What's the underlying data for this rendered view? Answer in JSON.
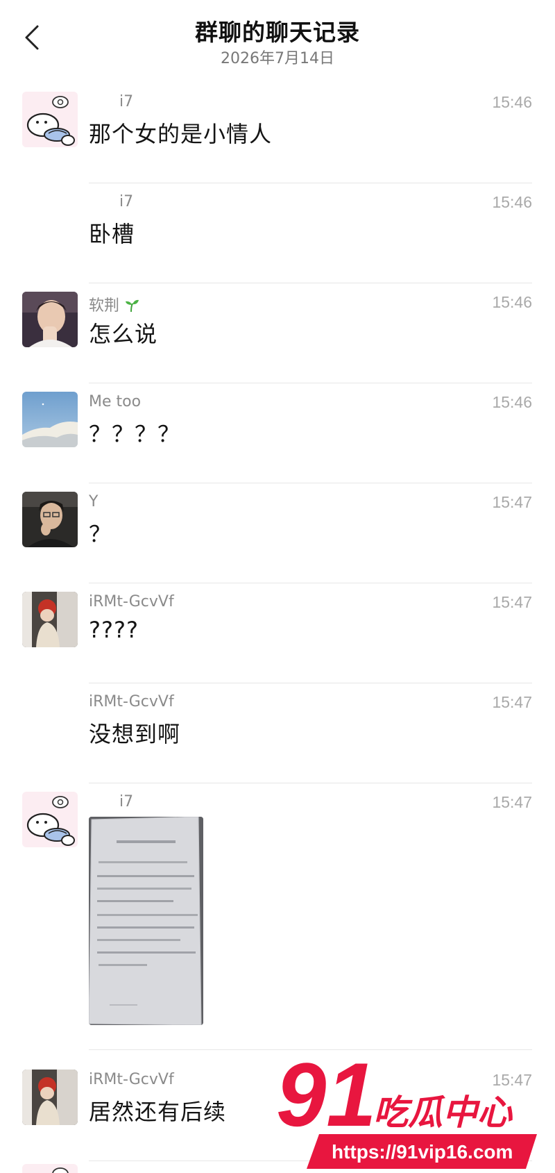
{
  "header": {
    "title": "群聊的聊天记录",
    "date": "2026年7月14日"
  },
  "messages": [
    {
      "sender": "i7",
      "time": "15:46",
      "text": "那个女的是小情人"
    },
    {
      "sender": "i7",
      "time": "15:46",
      "text": "卧槽"
    },
    {
      "sender": "软荆",
      "time": "15:46",
      "text": "怎么说"
    },
    {
      "sender": "Me too",
      "time": "15:46",
      "text": "？？？？"
    },
    {
      "sender": "Y",
      "time": "15:47",
      "text": "？"
    },
    {
      "sender": "iRMt-GcvVf",
      "time": "15:47",
      "text": "????"
    },
    {
      "sender": "iRMt-GcvVf",
      "time": "15:47",
      "text": "没想到啊"
    },
    {
      "sender": "i7",
      "time": "15:47",
      "text": ""
    },
    {
      "sender": "iRMt-GcvVf",
      "time": "15:47",
      "text": "居然还有后续"
    }
  ],
  "icons": {
    "back": "chevron-left-icon",
    "sprout": "sprout-icon"
  },
  "watermark": {
    "number": "91",
    "brand": "吃瓜中心",
    "url": "https://91vip16.com",
    "color": "#e8163f"
  }
}
